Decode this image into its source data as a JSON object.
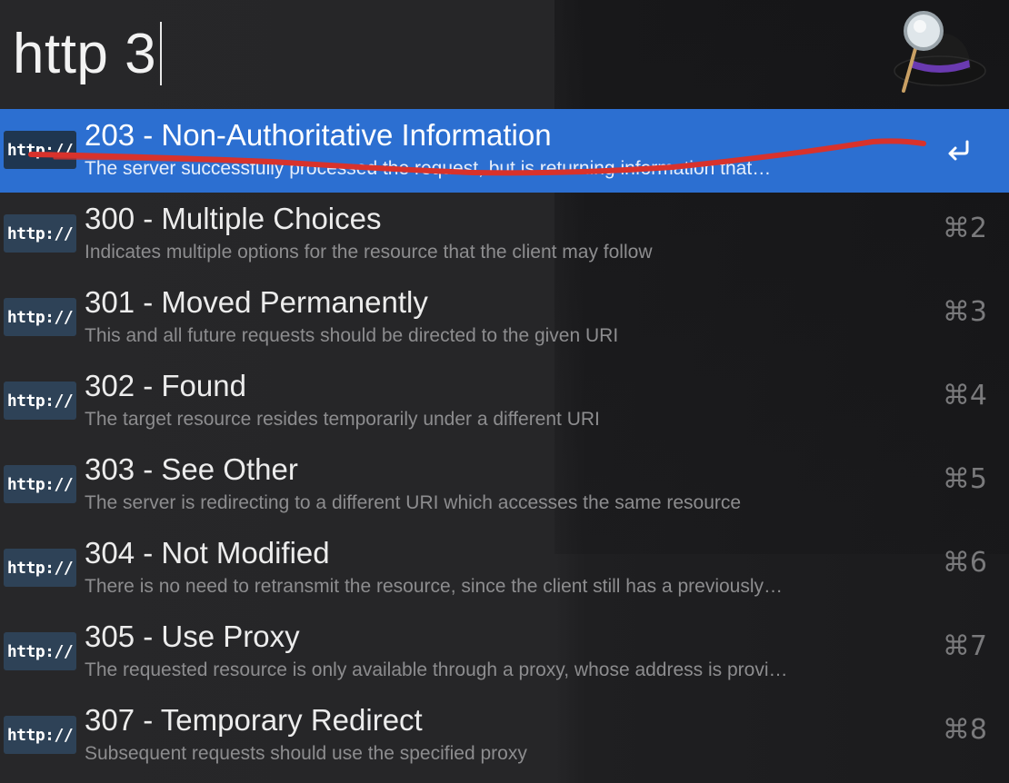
{
  "search": {
    "query": "http 3"
  },
  "logo": {
    "icon": "alfred-hat-icon"
  },
  "colors": {
    "selection": "#2c6fd1",
    "badge": "#2e4257",
    "annotation": "#d8322c"
  },
  "results": [
    {
      "badge": "http://",
      "title": "203 - Non-Authoritative Information",
      "subtitle": "The server successfully processed the request, but is returning information that…",
      "shortcut": "",
      "action_icon": "return-icon",
      "selected": true
    },
    {
      "badge": "http://",
      "title": "300 - Multiple Choices",
      "subtitle": "Indicates multiple options for the resource that the client may follow",
      "shortcut": "⌘2"
    },
    {
      "badge": "http://",
      "title": "301 - Moved Permanently",
      "subtitle": "This and all future requests should be directed to the given URI",
      "shortcut": "⌘3"
    },
    {
      "badge": "http://",
      "title": "302 - Found",
      "subtitle": "The target resource resides temporarily under a different URI",
      "shortcut": "⌘4"
    },
    {
      "badge": "http://",
      "title": "303 - See Other",
      "subtitle": "The server is redirecting to a different URI which accesses the same resource",
      "shortcut": "⌘5"
    },
    {
      "badge": "http://",
      "title": "304 - Not Modified",
      "subtitle": "There is no need to retransmit the resource, since the client still has a previously…",
      "shortcut": "⌘6"
    },
    {
      "badge": "http://",
      "title": "305 - Use Proxy",
      "subtitle": "The requested resource is only available through a proxy, whose address is provi…",
      "shortcut": "⌘7"
    },
    {
      "badge": "http://",
      "title": "307 - Temporary Redirect",
      "subtitle": "Subsequent requests should use the specified proxy",
      "shortcut": "⌘8"
    }
  ]
}
